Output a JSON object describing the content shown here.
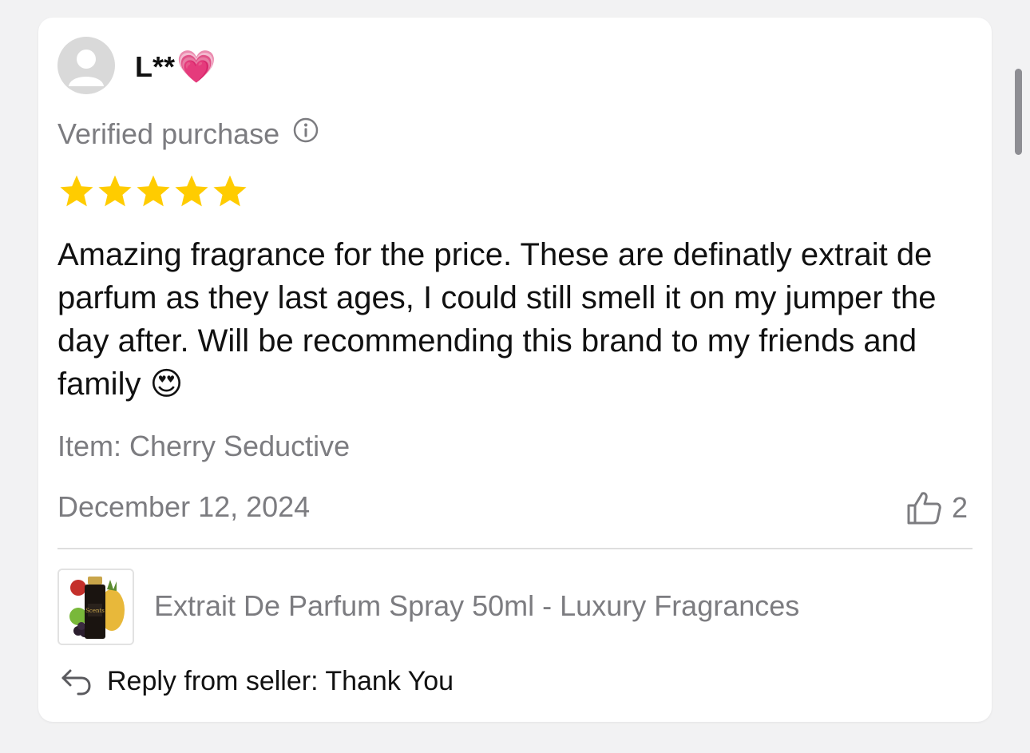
{
  "review": {
    "username": "L**",
    "username_emoji": "💗",
    "verified_label": "Verified purchase",
    "rating": 5,
    "rating_max": 5,
    "text": "Amazing fragrance for the price. These are definatly extrait de parfum as they last ages, I could still smell it on my jumper the day after. Will be recommending this brand to my friends and family 😍",
    "item_label": "Item: Cherry Seductive",
    "date": "December 12, 2024",
    "helpful_count": "2",
    "product_name": "Extrait De Parfum Spray 50ml - Luxury Fragrances",
    "seller_reply": "Reply from seller: Thank You"
  },
  "icons": {
    "info": "info-icon",
    "star": "star-icon",
    "thumbs_up": "thumbs-up-icon",
    "reply": "reply-arrow-icon"
  },
  "colors": {
    "star": "#FFCC00",
    "muted_text": "#7C7C80",
    "primary_text": "#111111",
    "card_bg": "#FFFFFF",
    "page_bg": "#F2F2F3"
  }
}
